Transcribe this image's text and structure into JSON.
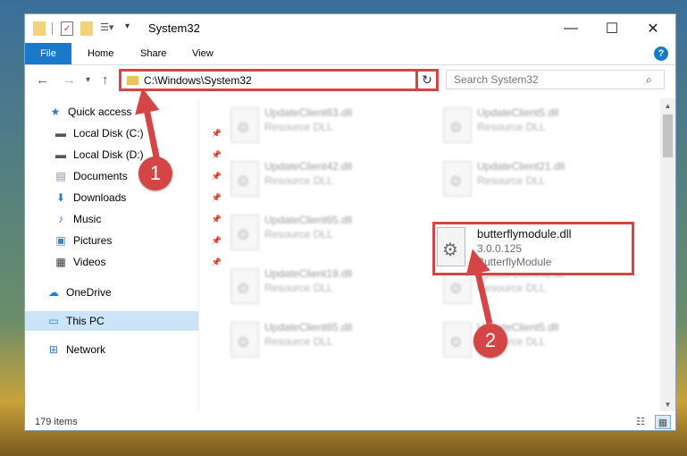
{
  "window": {
    "title": "System32",
    "controls": {
      "minimize": "—",
      "maximize": "☐",
      "close": "✕"
    }
  },
  "ribbon": {
    "tabs": [
      "File",
      "Home",
      "Share",
      "View"
    ],
    "help": "?"
  },
  "navigation": {
    "back": "←",
    "forward": "→",
    "recent": "▾",
    "up": "↑",
    "address_path": "C:\\Windows\\System32",
    "address_dropdown": "▾",
    "refresh": "↻",
    "search_placeholder": "Search System32",
    "search_icon": "search-icon"
  },
  "sidebar": {
    "items": [
      {
        "label": "Quick access",
        "icon": "star-icon",
        "pinned": false
      },
      {
        "label": "Local Disk (C:)",
        "icon": "drive-icon",
        "pinned": true
      },
      {
        "label": "Local Disk (D:)",
        "icon": "drive-icon",
        "pinned": true
      },
      {
        "label": "Documents",
        "icon": "document-icon",
        "pinned": true
      },
      {
        "label": "Downloads",
        "icon": "download-icon",
        "pinned": true
      },
      {
        "label": "Music",
        "icon": "music-icon",
        "pinned": true
      },
      {
        "label": "Pictures",
        "icon": "pictures-icon",
        "pinned": true
      },
      {
        "label": "Videos",
        "icon": "video-icon",
        "pinned": true
      },
      {
        "label": "OneDrive",
        "icon": "cloud-icon",
        "pinned": false
      },
      {
        "label": "This PC",
        "icon": "computer-icon",
        "pinned": false,
        "selected": true
      },
      {
        "label": "Network",
        "icon": "network-icon",
        "pinned": false
      }
    ]
  },
  "files": {
    "left_column": [
      {
        "name": "UpdateClient63.dll",
        "type": "Resource DLL"
      },
      {
        "name": "UpdateClient42.dll",
        "type": "Resource DLL"
      },
      {
        "name": "UpdateClient65.dll",
        "type": "Resource DLL"
      },
      {
        "name": "UpdateClient19.dll",
        "type": "Resource DLL"
      },
      {
        "name": "UpdateClient65.dll",
        "type": "Resource DLL"
      }
    ],
    "right_column": [
      {
        "name": "UpdateClient5.dll",
        "type": "Resource DLL"
      },
      {
        "name": "UpdateClient21.dll",
        "type": "Resource DLL"
      },
      {
        "name": "UpdateClient42.dll",
        "type": "Resource DLL"
      },
      {
        "name": "UpdateClient5.dll",
        "type": "Resource DLL"
      }
    ],
    "highlighted": {
      "name": "butterflymodule.dll",
      "version": "3.0.0.125",
      "description": "ButterflyModule"
    }
  },
  "status": {
    "item_count": "179 items"
  },
  "annotations": {
    "step1": "1",
    "step2": "2",
    "color": "#d64545"
  }
}
